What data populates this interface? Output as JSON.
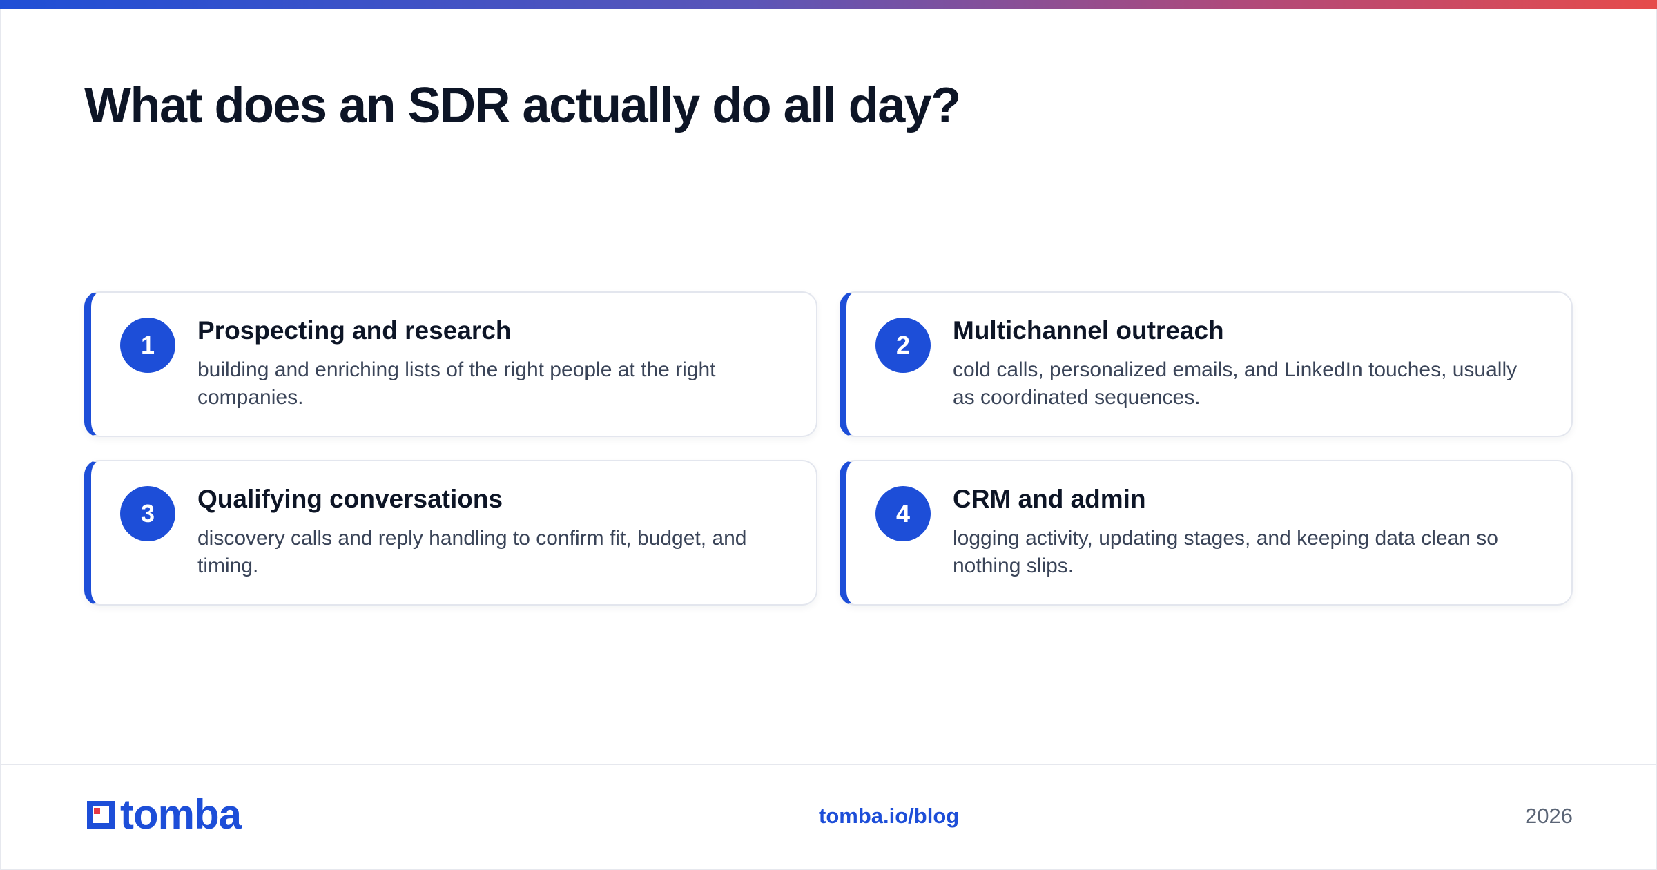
{
  "page": {
    "title": "What does an SDR actually do all day?"
  },
  "cards": [
    {
      "number": "1",
      "title": "Prospecting and research",
      "description": "building and enriching lists of the right people at the right companies."
    },
    {
      "number": "2",
      "title": "Multichannel outreach",
      "description": "cold calls, personalized emails, and LinkedIn touches, usually as coordinated sequences."
    },
    {
      "number": "3",
      "title": "Qualifying conversations",
      "description": "discovery calls and reply handling to confirm fit, budget, and timing."
    },
    {
      "number": "4",
      "title": "CRM and admin",
      "description": "logging activity, updating stages, and keeping data clean so nothing slips."
    }
  ],
  "footer": {
    "logo_text": "tomba",
    "link": "tomba.io/blog",
    "year": "2026"
  },
  "colors": {
    "accent": "#1d4ed8",
    "logo_red": "#e63946",
    "gradient_start": "#1f4fd6",
    "gradient_end": "#e64b4b",
    "title_text": "#0d1526",
    "body_text": "#3a4458"
  },
  "icons": {
    "logo_mark": "tomba-logo-icon"
  }
}
